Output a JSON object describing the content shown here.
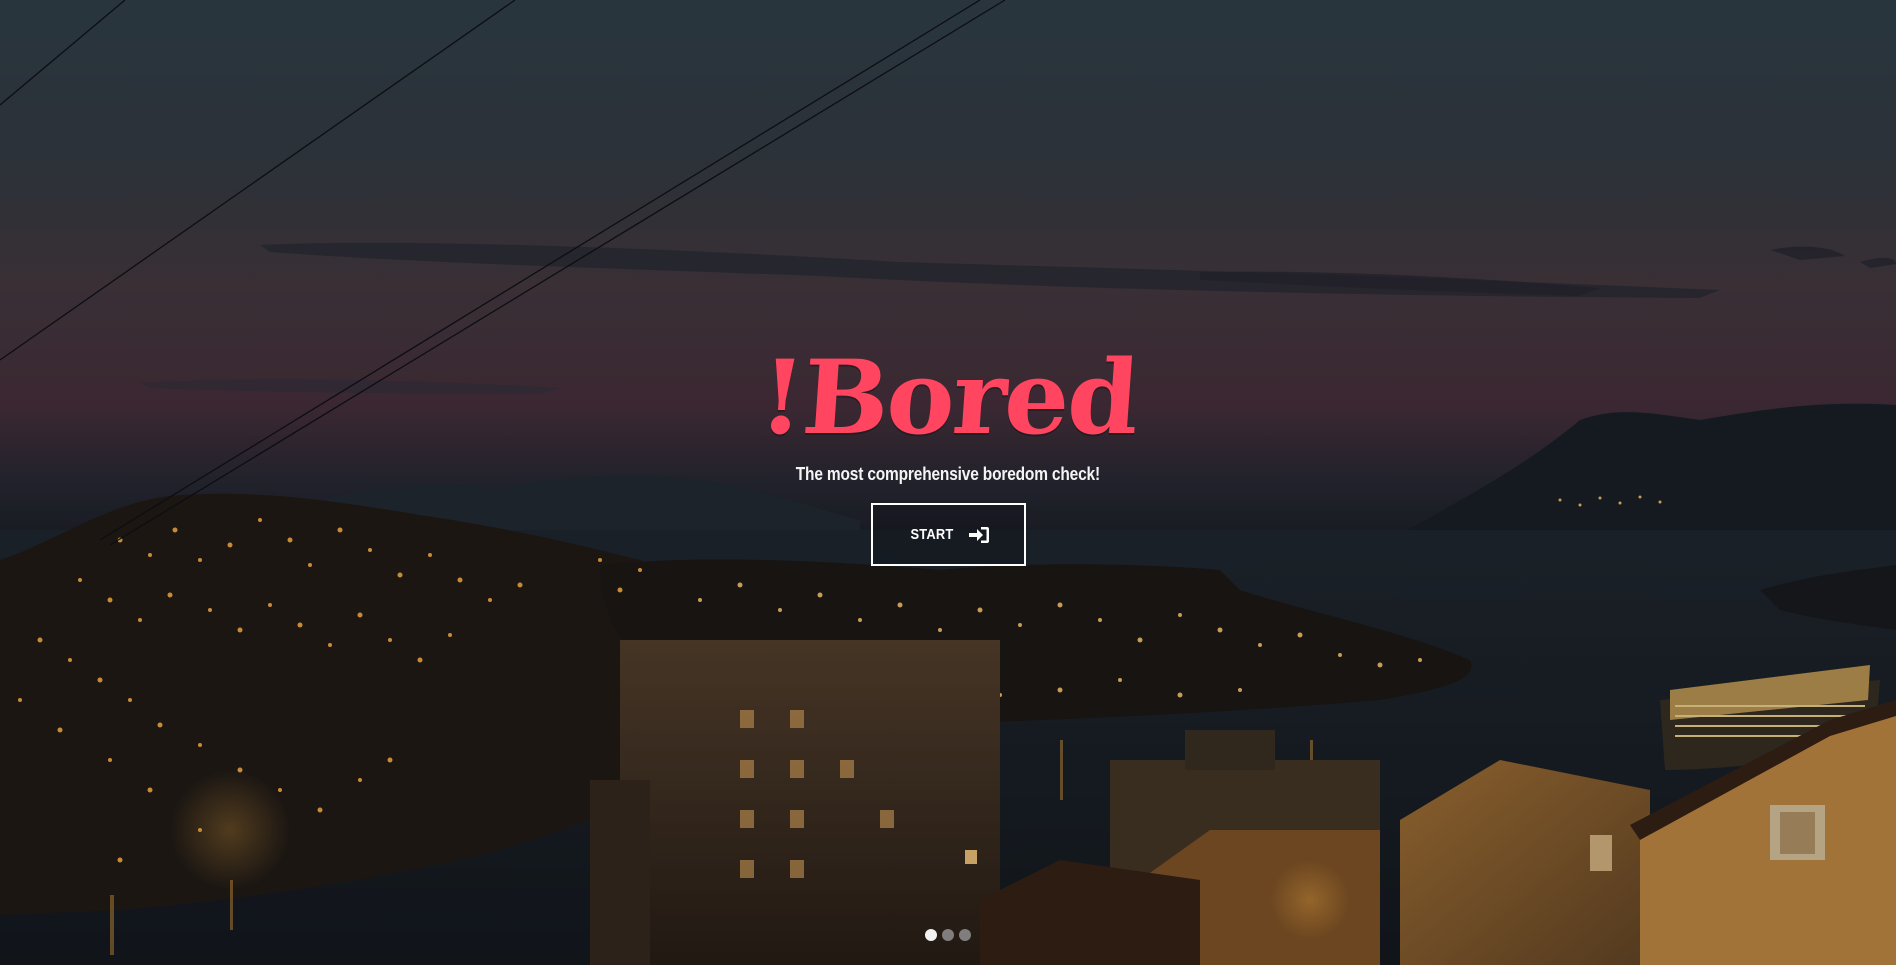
{
  "hero": {
    "logo_text": "!Bored",
    "tagline": "The most comprehensive boredom check!",
    "start_label": "START",
    "start_icon": "sign-in-icon",
    "background": "night-harbor-city-photo"
  },
  "carousel": {
    "slide_count": 3,
    "active_index": 0
  },
  "colors": {
    "brand": "#ff4560",
    "text": "#ffffff",
    "dot_active": "#f2f2f2",
    "dot_inactive": "#a0a0a0"
  }
}
